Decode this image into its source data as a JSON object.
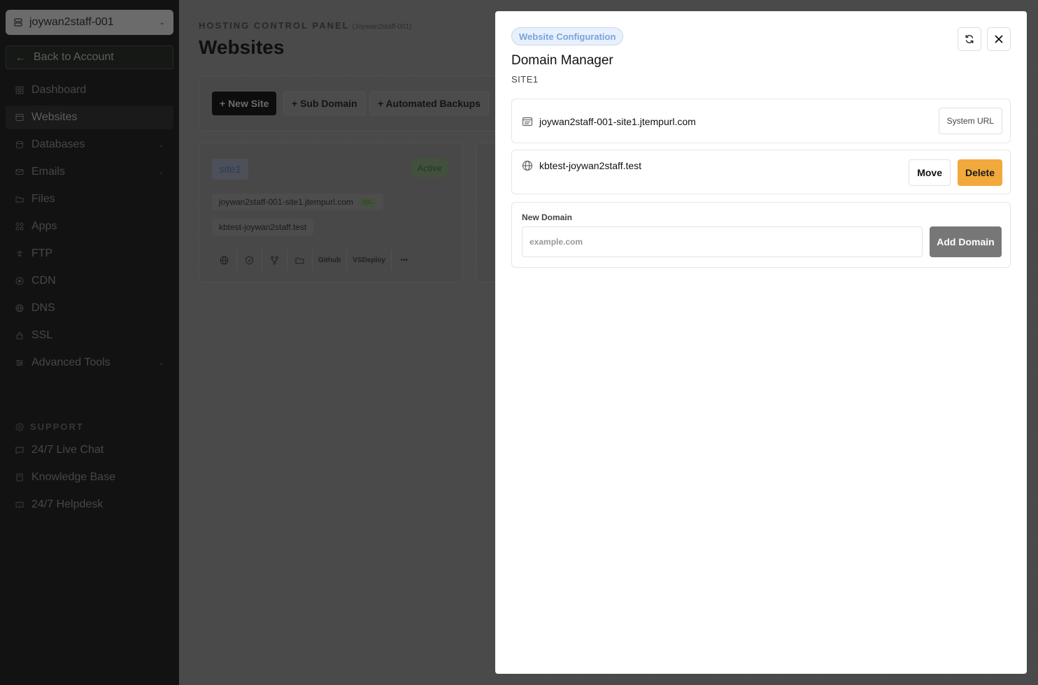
{
  "sidebar": {
    "account_name": "joywan2staff-001",
    "back_label": "Back to Account",
    "items": [
      {
        "label": "Dashboard",
        "icon": "grid-icon",
        "has_chevron": false
      },
      {
        "label": "Websites",
        "icon": "browser-icon",
        "has_chevron": false,
        "active": true
      },
      {
        "label": "Databases",
        "icon": "database-icon",
        "has_chevron": true
      },
      {
        "label": "Emails",
        "icon": "mail-icon",
        "has_chevron": true
      },
      {
        "label": "Files",
        "icon": "folder-icon",
        "has_chevron": false
      },
      {
        "label": "Apps",
        "icon": "apps-icon",
        "has_chevron": false
      },
      {
        "label": "FTP",
        "icon": "ftp-icon",
        "has_chevron": false
      },
      {
        "label": "CDN",
        "icon": "cdn-icon",
        "has_chevron": false
      },
      {
        "label": "DNS",
        "icon": "globe-icon",
        "has_chevron": false
      },
      {
        "label": "SSL",
        "icon": "lock-icon",
        "has_chevron": false
      },
      {
        "label": "Advanced Tools",
        "icon": "sliders-icon",
        "has_chevron": true
      }
    ],
    "support_heading": "SUPPORT",
    "support_items": [
      {
        "label": "24/7 Live Chat",
        "icon": "chat-icon"
      },
      {
        "label": "Knowledge Base",
        "icon": "book-icon"
      },
      {
        "label": "24/7 Helpdesk",
        "icon": "ticket-icon"
      }
    ]
  },
  "header": {
    "kicker": "HOSTING CONTROL PANEL",
    "kicker_account": "(Joywan2staff-001)",
    "title": "Websites"
  },
  "toolbar": {
    "new_site": "+ New Site",
    "sub_domain": "+ Sub Domain",
    "automated_backups": "+ Automated Backups"
  },
  "site_card": {
    "name": "site1",
    "status": "Active",
    "domains": [
      "joywan2staff-001-site1.jtempurl.com",
      "kbtest-joywan2staff.test"
    ],
    "ssl_badge": "SSL",
    "actions": [
      "Github",
      "VSDeploy",
      "•••"
    ]
  },
  "modal": {
    "badge": "Website Configuration",
    "title": "Domain Manager",
    "subtitle": "SITE1",
    "system_domain": "joywan2staff-001-site1.jtempurl.com",
    "system_url_label": "System URL",
    "custom_domain": "kbtest-joywan2staff.test",
    "move_label": "Move",
    "delete_label": "Delete",
    "new_domain_label": "New Domain",
    "new_domain_placeholder": "example.com",
    "new_domain_value": "",
    "add_domain_label": "Add Domain"
  },
  "colors": {
    "delete_button": "#f0a93a",
    "badge_text": "#7aa3e0",
    "add_button": "#777777"
  }
}
